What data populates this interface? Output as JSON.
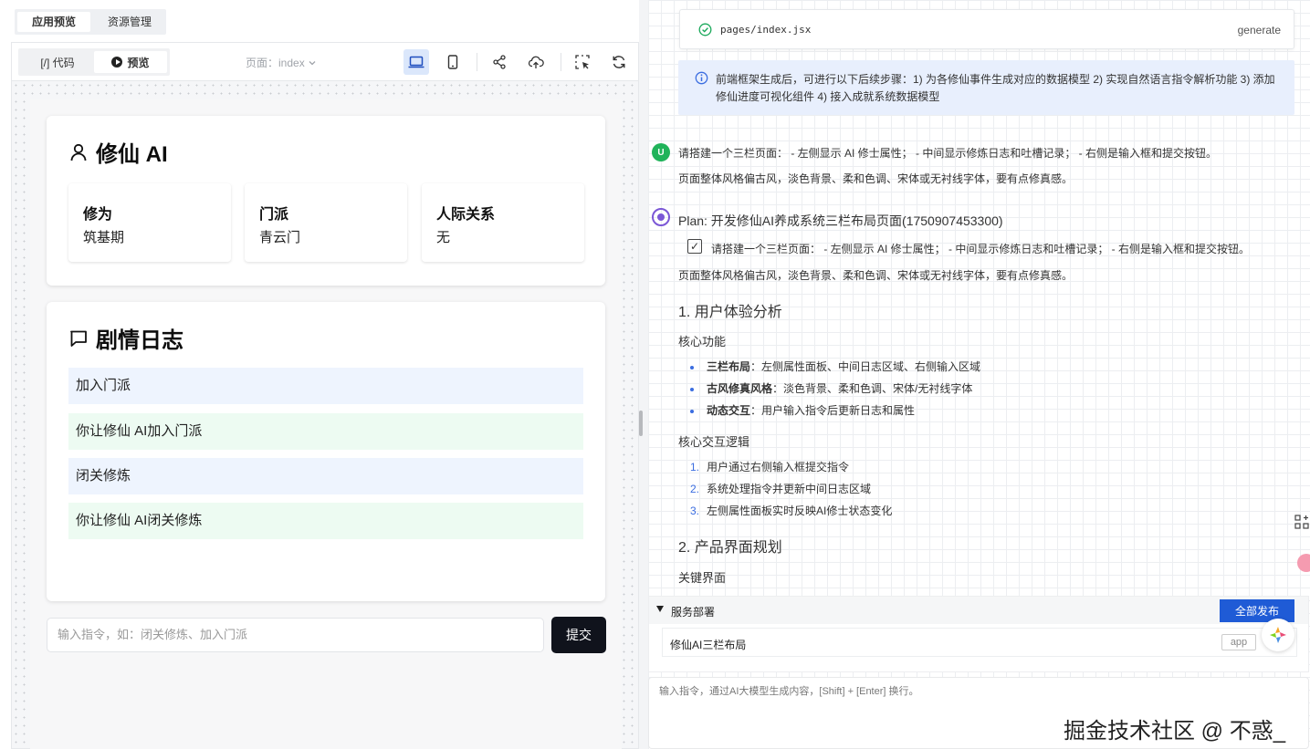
{
  "top_tabs": [
    "应用预览",
    "资源管理"
  ],
  "toolbar": {
    "code_label": "[/] 代码",
    "preview_label": "预览",
    "page_select": "页面：index"
  },
  "app": {
    "profile_title": "修仙 AI",
    "attributes": [
      {
        "label": "修为",
        "value": "筑基期"
      },
      {
        "label": "门派",
        "value": "青云门"
      },
      {
        "label": "人际关系",
        "value": "无"
      }
    ],
    "log_title": "剧情日志",
    "logs": [
      "加入门派",
      "你让修仙 AI加入门派",
      "闭关修炼",
      "你让修仙 AI闭关修炼"
    ],
    "input_placeholder": "输入指令，如：闭关修炼、加入门派",
    "submit_label": "提交"
  },
  "chat": {
    "file_name": "pages/index.jsx",
    "file_action": "generate",
    "info": "前端框架生成后，可进行以下后续步骤：1) 为各修仙事件生成对应的数据模型 2) 实现自然语言指令解析功能 3) 添加修仙进度可视化组件 4) 接入成就系统数据模型",
    "user_avatar": "U",
    "user_msg_line1": "请搭建一个三栏页面： - 左侧显示 AI 修士属性； - 中间显示修炼日志和吐槽记录； - 右侧是输入框和提交按钮。",
    "user_msg_line2": "页面整体风格偏古风，淡色背景、柔和色调、宋体或无衬线字体，要有点修真感。",
    "plan_title": "Plan: 开发修仙AI养成系统三栏布局页面(1750907453300)",
    "plan_task_line1": "请搭建一个三栏页面： - 左侧显示 AI 修士属性； - 中间显示修炼日志和吐槽记录； - 右侧是输入框和提交按钮。",
    "plan_task_line2": "页面整体风格偏古风，淡色背景、柔和色调、宋体或无衬线字体，要有点修真感。",
    "section1": "1. 用户体验分析",
    "core_features_title": "核心功能",
    "core_features": [
      {
        "bold": "三栏布局",
        "text": "：左侧属性面板、中间日志区域、右侧输入区域"
      },
      {
        "bold": "古风修真风格",
        "text": "：淡色背景、柔和色调、宋体/无衬线字体"
      },
      {
        "bold": "动态交互",
        "text": "：用户输入指令后更新日志和属性"
      }
    ],
    "core_logic_title": "核心交互逻辑",
    "core_logic": [
      "用户通过右侧输入框提交指令",
      "系统处理指令并更新中间日志区域",
      "左侧属性面板实时反映AI修士状态变化"
    ],
    "logic_nums": [
      "1.",
      "2.",
      "3."
    ],
    "section2": "2. 产品界面规划",
    "key_ui_title": "关键界面"
  },
  "deploy": {
    "title": "服务部署",
    "publish_label": "全部发布",
    "item_name": "修仙AI三栏布局",
    "item_tag": "app"
  },
  "prompt": {
    "placeholder": "输入指令，通过AI大模型生成内容，[Shift] + [Enter] 换行。"
  },
  "watermark": "掘金技术社区 @ 不惑_",
  "colors": {
    "accent": "#1f5bd6",
    "submit": "#10131c",
    "log_blue": "#eef4fe",
    "log_green": "#edfbf2",
    "info_bg": "#e8effd"
  }
}
